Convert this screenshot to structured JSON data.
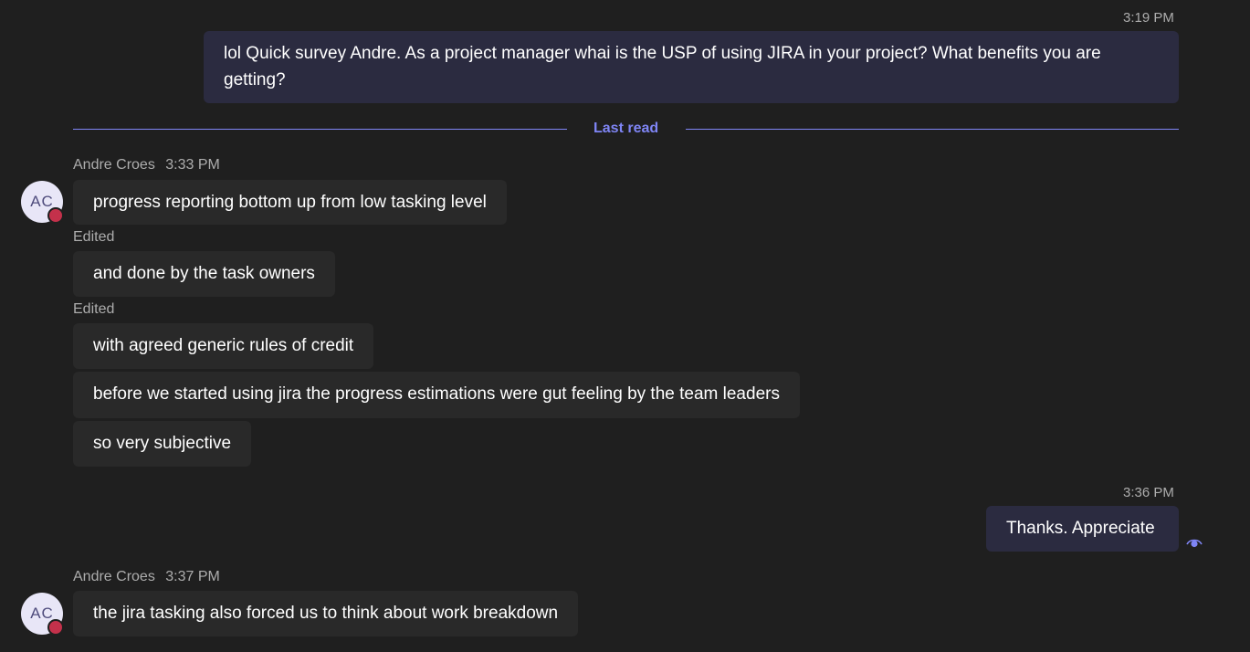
{
  "messages_out": [
    {
      "time": "3:19 PM",
      "text": "lol Quick survey Andre. As a project manager whai is the USP of using JIRA in your project? What benefits you are getting?"
    },
    {
      "time": "3:36 PM",
      "text": "Thanks. Appreciate"
    }
  ],
  "divider": {
    "label": "Last read"
  },
  "group1": {
    "author": "Andre Croes",
    "time": "3:33 PM",
    "avatar_initials": "AC",
    "messages": [
      "progress reporting bottom up from low tasking level",
      "and done by the task owners",
      "with agreed generic rules of credit",
      "before we started using jira the progress estimations were gut feeling by the team leaders",
      "so very subjective"
    ],
    "edited_label": "Edited"
  },
  "group2": {
    "author": "Andre Croes",
    "time": "3:37 PM",
    "avatar_initials": "AC",
    "messages": [
      "the jira tasking also forced us to think about work breakdown"
    ]
  },
  "colors": {
    "background": "#1f1f1f",
    "outgoing_bubble": "#2b2b40",
    "incoming_bubble": "#292929",
    "accent": "#7f85f5",
    "presence_busy": "#c4314b"
  },
  "icons": {
    "read_receipt": "seen-eye-icon",
    "presence": "presence-busy-icon"
  }
}
